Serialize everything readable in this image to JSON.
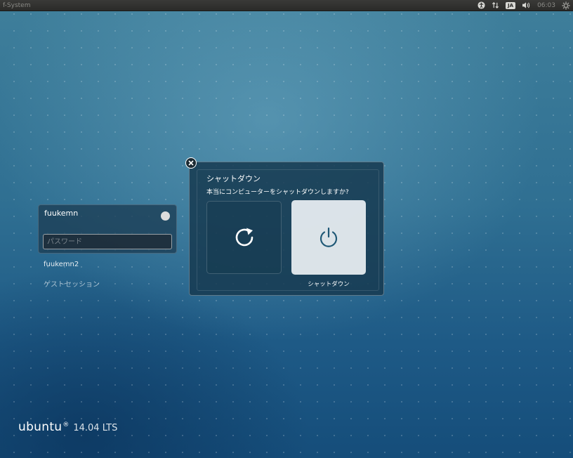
{
  "top_panel": {
    "host_name": "f-System",
    "clock": "06:03",
    "keyboard_indicator": "JA",
    "icons": [
      "accessibility-icon",
      "network-icon",
      "keyboard-layout-icon",
      "volume-icon",
      "power-gear-icon"
    ]
  },
  "login": {
    "selected_user": "fuukemn",
    "password_placeholder": "パスワード",
    "password_value": "",
    "other_users": [
      "fuukemn2",
      "ゲストセッション"
    ]
  },
  "dialog": {
    "title": "シャットダウン",
    "message": "本当にコンピューターをシャットダウンしますか?",
    "actions": [
      {
        "name": "restart",
        "icon": "restart-icon",
        "label": ""
      },
      {
        "name": "shutdown",
        "icon": "power-icon",
        "label": "シャットダウン"
      }
    ]
  },
  "branding": {
    "word": "ubuntu",
    "mark": "®",
    "version": "14.04 LTS"
  },
  "colors": {
    "panel": "#2b2b29",
    "background_top": "#3f7f9b",
    "background_bottom": "#154d7a",
    "highlight_button": "#e6ecf0"
  }
}
